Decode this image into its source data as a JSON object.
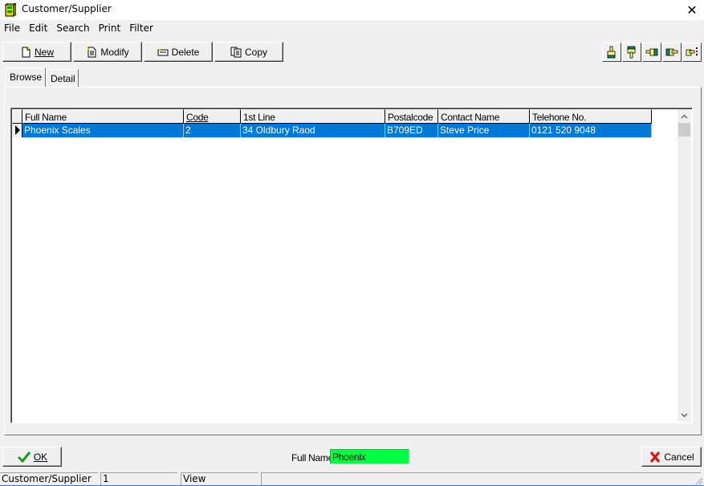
{
  "window": {
    "title": "Customer/Supplier",
    "icon": "cabinet-icon",
    "close_glyph": "✕"
  },
  "menu": [
    "File",
    "Edit",
    "Search",
    "Print",
    "Filter"
  ],
  "toolbar": {
    "new_label": "New",
    "modify_label": "Modify",
    "delete_label": "Delete",
    "copy_label": "Copy",
    "nav_icons": [
      "hand-first-icon",
      "hand-last-icon",
      "hand-previous-icon",
      "hand-next-icon",
      "hand-end-icon"
    ]
  },
  "tabs": [
    {
      "label": "Browse",
      "active": true
    },
    {
      "label": "Detail",
      "active": false
    }
  ],
  "grid": {
    "columns": [
      "Full Name",
      "Code",
      "1st Line",
      "Postalcode",
      "Contact Name",
      "Telehone No."
    ],
    "rows": [
      [
        "Phoenix Scales",
        "2",
        "34 Oldbury Raod",
        "B709ED",
        "Steve Price",
        "0121 520 9048"
      ]
    ],
    "selected_row": 0,
    "selection_color": "#0078d7"
  },
  "footer": {
    "ok_label": "OK",
    "cancel_label": "Cancel",
    "search_label": "Full Name",
    "search_value": "Phoenix",
    "search_bg": "#00ff40"
  },
  "status": {
    "panel1": "Customer/Supplier",
    "panel2": "1",
    "panel3": "View",
    "panel4": ""
  }
}
